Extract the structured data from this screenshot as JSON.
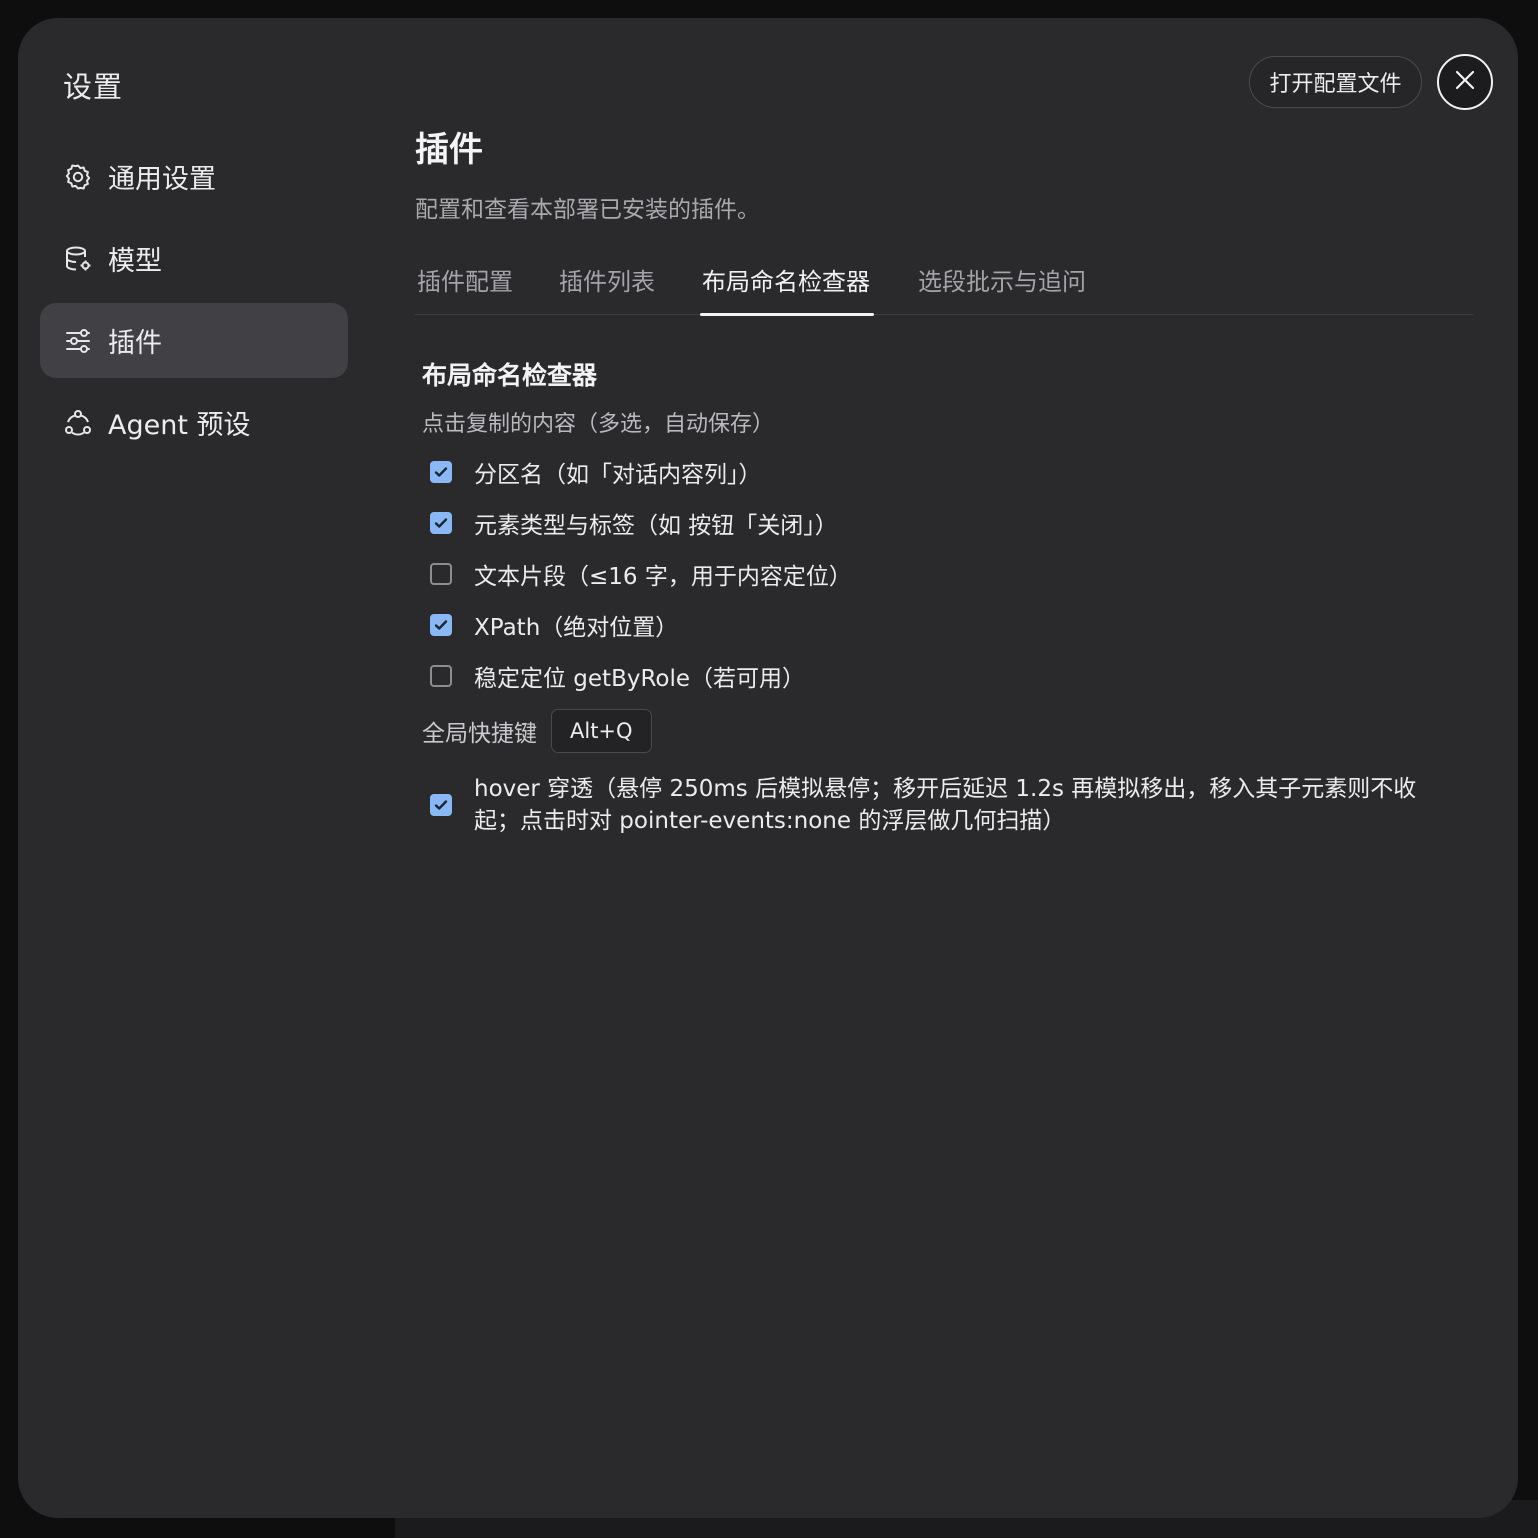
{
  "modal": {
    "title": "设置",
    "open_config_label": "打开配置文件"
  },
  "sidebar": {
    "items": [
      {
        "label": "通用设置",
        "icon": "gear-icon",
        "active": false
      },
      {
        "label": "模型",
        "icon": "database-icon",
        "active": false
      },
      {
        "label": "插件",
        "icon": "sliders-icon",
        "active": true
      },
      {
        "label": "Agent 预设",
        "icon": "agent-icon",
        "active": false
      }
    ]
  },
  "main": {
    "title": "插件",
    "description": "配置和查看本部署已安装的插件。",
    "tabs": [
      {
        "label": "插件配置",
        "active": false
      },
      {
        "label": "插件列表",
        "active": false
      },
      {
        "label": "布局命名检查器",
        "active": true
      },
      {
        "label": "选段批示与追问",
        "active": false
      }
    ]
  },
  "inspector": {
    "title": "布局命名检查器",
    "copy_content_label": "点击复制的内容（多选，自动保存）",
    "options": [
      {
        "label": "分区名（如「对话内容列」）",
        "checked": true
      },
      {
        "label": "元素类型与标签（如 按钮「关闭」）",
        "checked": true
      },
      {
        "label": "文本片段（≤16 字，用于内容定位）",
        "checked": false
      },
      {
        "label": "XPath（绝对位置）",
        "checked": true
      },
      {
        "label": "稳定定位 getByRole（若可用）",
        "checked": false
      }
    ],
    "shortcut_label": "全局快捷键",
    "shortcut_value": "Alt+Q",
    "hover_option": {
      "label": "hover 穿透（悬停 250ms 后模拟悬停；移开后延迟 1.2s 再模拟移出，移入其子元素则不收起；点击时对 pointer-events:none 的浮层做几何扫描）",
      "checked": true
    }
  },
  "colors": {
    "modal_bg": "#2a2a2d",
    "active_nav_bg": "#404045",
    "checkbox_accent": "#8ab8f5"
  }
}
